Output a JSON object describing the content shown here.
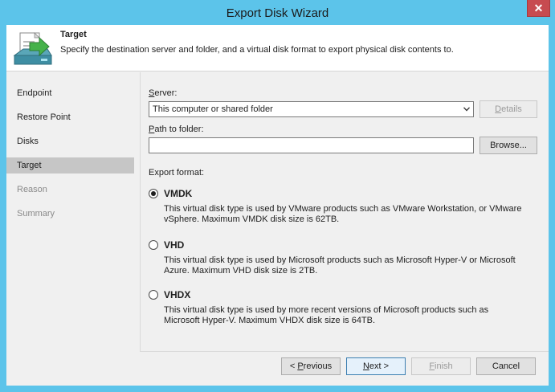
{
  "window": {
    "title": "Export Disk Wizard",
    "close_glyph": "✕"
  },
  "header": {
    "title": "Target",
    "description": "Specify the destination server and folder, and a virtual disk format to export physical disk contents to."
  },
  "nav": {
    "items": [
      {
        "label": "Endpoint",
        "state": "normal"
      },
      {
        "label": "Restore Point",
        "state": "normal"
      },
      {
        "label": "Disks",
        "state": "normal"
      },
      {
        "label": "Target",
        "state": "active"
      },
      {
        "label": "Reason",
        "state": "disabled"
      },
      {
        "label": "Summary",
        "state": "disabled"
      }
    ]
  },
  "form": {
    "server_label_first": "S",
    "server_label_rest": "erver:",
    "server_value": "This computer or shared folder",
    "details_first": "D",
    "details_rest": "etails",
    "path_label_first": "P",
    "path_label_rest": "ath to folder:",
    "path_value": "",
    "browse_label": "Browse...",
    "export_format_label": "Export format:",
    "options": [
      {
        "title": "VMDK",
        "selected": true,
        "description": "This virtual disk type is used by VMware products such as VMware Workstation, or VMware vSphere. Maximum VMDK disk size is 62TB."
      },
      {
        "title": "VHD",
        "selected": false,
        "description": "This virtual disk type is used by Microsoft products such as Microsoft Hyper-V or Microsoft Azure. Maximum VHD disk size is 2TB."
      },
      {
        "title": "VHDX",
        "selected": false,
        "description": "This virtual disk type is used by more recent versions of Microsoft products such as Microsoft Hyper-V. Maximum VHDX disk size is 64TB."
      }
    ]
  },
  "footer": {
    "previous_prefix": "< ",
    "previous_first": "P",
    "previous_rest": "revious",
    "next_first": "N",
    "next_rest": "ext >",
    "finish_first": "F",
    "finish_rest": "inish",
    "cancel_label": "Cancel"
  },
  "colors": {
    "titlebar": "#5cc4ea",
    "close": "#c74b50",
    "active_nav": "#c6c6c6"
  },
  "icons": {
    "header": "export-disk-icon",
    "close": "close-icon",
    "dropdown": "chevron-down-icon"
  }
}
